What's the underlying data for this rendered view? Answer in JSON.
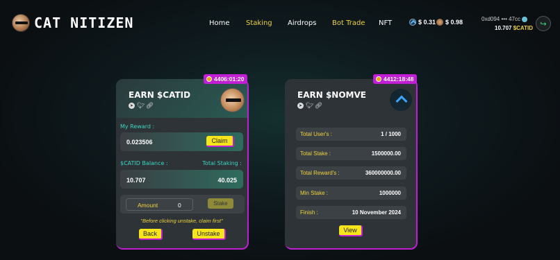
{
  "header": {
    "brand": "CAT NITIZEN",
    "nav": [
      {
        "label": "Home",
        "active": false
      },
      {
        "label": "Staking",
        "active": true
      },
      {
        "label": "Airdrops",
        "active": false
      },
      {
        "label": "Bot Trade",
        "active": true
      },
      {
        "label": "NFT",
        "active": false
      }
    ],
    "prices": {
      "nomve": "$ 0.31",
      "catid": "$ 0.98"
    },
    "wallet": {
      "address": "0xd094 ••• 47cc",
      "balance": "10.707",
      "token": "$CATID"
    },
    "accent_color": "#f0d33c"
  },
  "cards": {
    "catid": {
      "timer": "4406:01:20",
      "title": "EARN $CATID",
      "my_reward_label": "My Reward :",
      "reward_value": "0.023506",
      "claim_label": "Claim",
      "balance_label": "$CATID Balance :",
      "total_staking_label": "Total Staking :",
      "balance_value": "10.707",
      "total_staking_value": "40.025",
      "amount_label": "Amount",
      "amount_value": "0",
      "stake_label": "Stake",
      "note": "\"Before clicking unstake, claim first\"",
      "back_label": "Back",
      "unstake_label": "Unstake"
    },
    "nomve": {
      "timer": "4412:18:48",
      "title": "EARN $NOMVE",
      "rows": [
        {
          "label": "Total User's :",
          "value": "1 / 1000"
        },
        {
          "label": "Total Stake :",
          "value": "1500000.00"
        },
        {
          "label": "Total Reward's :",
          "value": "360000000.00"
        },
        {
          "label": "Min Stake :",
          "value": "1000000"
        },
        {
          "label": "Finish :",
          "value": "10 November 2024"
        }
      ],
      "view_label": "View"
    }
  },
  "colors": {
    "border_accent": "#c21ed6",
    "button_yellow": "#f7e51c",
    "label_teal": "#3ad7c1"
  }
}
